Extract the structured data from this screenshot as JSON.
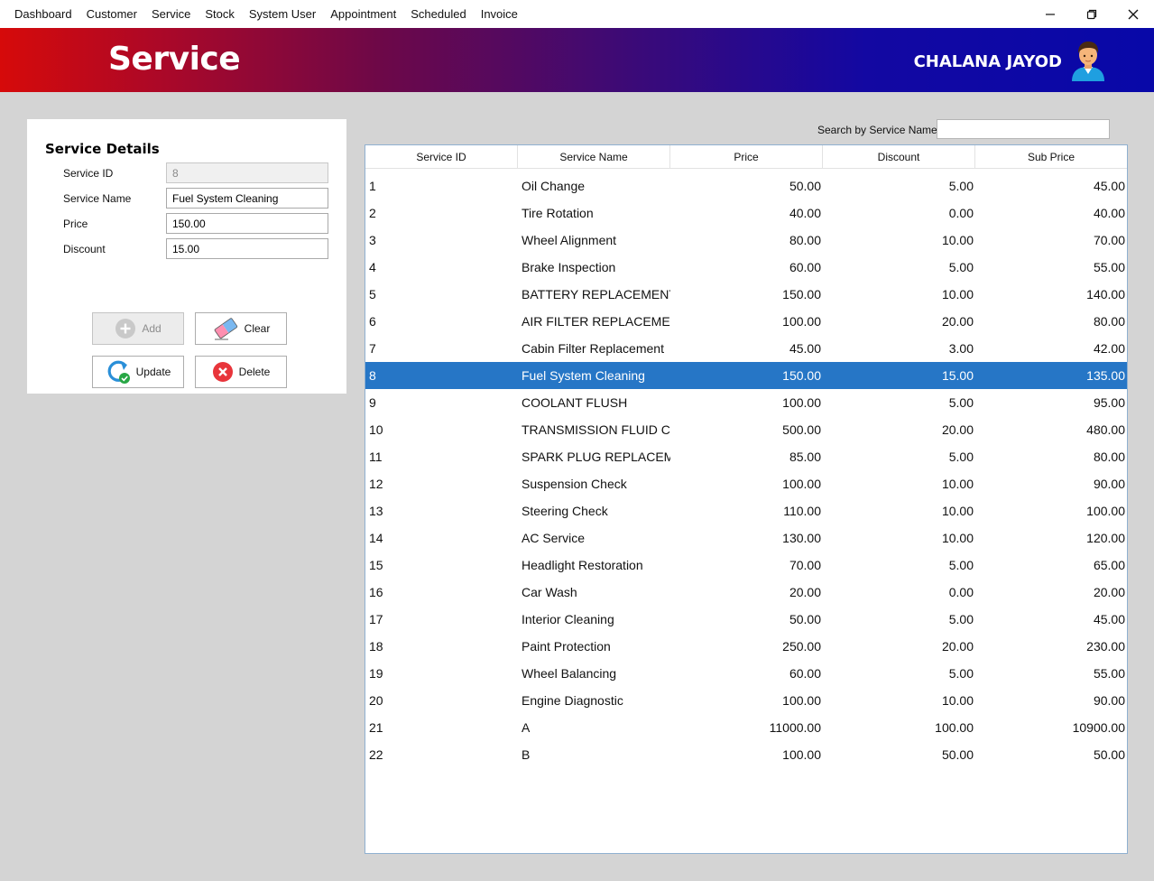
{
  "menu": [
    "Dashboard",
    "Customer",
    "Service",
    "Stock",
    "System User",
    "Appointment",
    "Scheduled",
    "Invoice"
  ],
  "header": {
    "title": "Service",
    "user": "CHALANA JAYOD"
  },
  "form": {
    "title": "Service Details",
    "fields": [
      {
        "label": "Service ID",
        "value": "8"
      },
      {
        "label": "Service Name",
        "value": "Fuel System Cleaning"
      },
      {
        "label": "Price",
        "value": "150.00"
      },
      {
        "label": "Discount",
        "value": "15.00"
      }
    ],
    "buttons": {
      "add": "Add",
      "clear": "Clear",
      "update": "Update",
      "delete": "Delete"
    }
  },
  "search": {
    "label": "Search by Service Name",
    "value": ""
  },
  "table": {
    "columns": [
      "Service ID",
      "Service Name",
      "Price",
      "Discount",
      "Sub Price"
    ],
    "selected_row": 7,
    "rows": [
      [
        "1",
        "Oil Change",
        "50.00",
        "5.00",
        "45.00"
      ],
      [
        "2",
        "Tire Rotation",
        "40.00",
        "0.00",
        "40.00"
      ],
      [
        "3",
        "Wheel Alignment",
        "80.00",
        "10.00",
        "70.00"
      ],
      [
        "4",
        "Brake Inspection",
        "60.00",
        "5.00",
        "55.00"
      ],
      [
        "5",
        "BATTERY REPLACEMENT",
        "150.00",
        "10.00",
        "140.00"
      ],
      [
        "6",
        "AIR FILTER REPLACEMENT",
        "100.00",
        "20.00",
        "80.00"
      ],
      [
        "7",
        "Cabin Filter Replacement",
        "45.00",
        "3.00",
        "42.00"
      ],
      [
        "8",
        "Fuel System Cleaning",
        "150.00",
        "15.00",
        "135.00"
      ],
      [
        "9",
        "COOLANT FLUSH",
        "100.00",
        "5.00",
        "95.00"
      ],
      [
        "10",
        "TRANSMISSION FLUID C...",
        "500.00",
        "20.00",
        "480.00"
      ],
      [
        "11",
        "SPARK PLUG REPLACEM...",
        "85.00",
        "5.00",
        "80.00"
      ],
      [
        "12",
        "Suspension Check",
        "100.00",
        "10.00",
        "90.00"
      ],
      [
        "13",
        "Steering Check",
        "110.00",
        "10.00",
        "100.00"
      ],
      [
        "14",
        "AC Service",
        "130.00",
        "10.00",
        "120.00"
      ],
      [
        "15",
        "Headlight Restoration",
        "70.00",
        "5.00",
        "65.00"
      ],
      [
        "16",
        "Car Wash",
        "20.00",
        "0.00",
        "20.00"
      ],
      [
        "17",
        "Interior Cleaning",
        "50.00",
        "5.00",
        "45.00"
      ],
      [
        "18",
        "Paint Protection",
        "250.00",
        "20.00",
        "230.00"
      ],
      [
        "19",
        "Wheel Balancing",
        "60.00",
        "5.00",
        "55.00"
      ],
      [
        "20",
        "Engine Diagnostic",
        "100.00",
        "10.00",
        "90.00"
      ],
      [
        "21",
        "A",
        "11000.00",
        "100.00",
        "10900.00"
      ],
      [
        "22",
        "B",
        "100.00",
        "50.00",
        "50.00"
      ]
    ]
  },
  "colors": {
    "selected_row": "#2676c6",
    "banner_left": "#d60a0a",
    "banner_right": "#0808a8"
  }
}
